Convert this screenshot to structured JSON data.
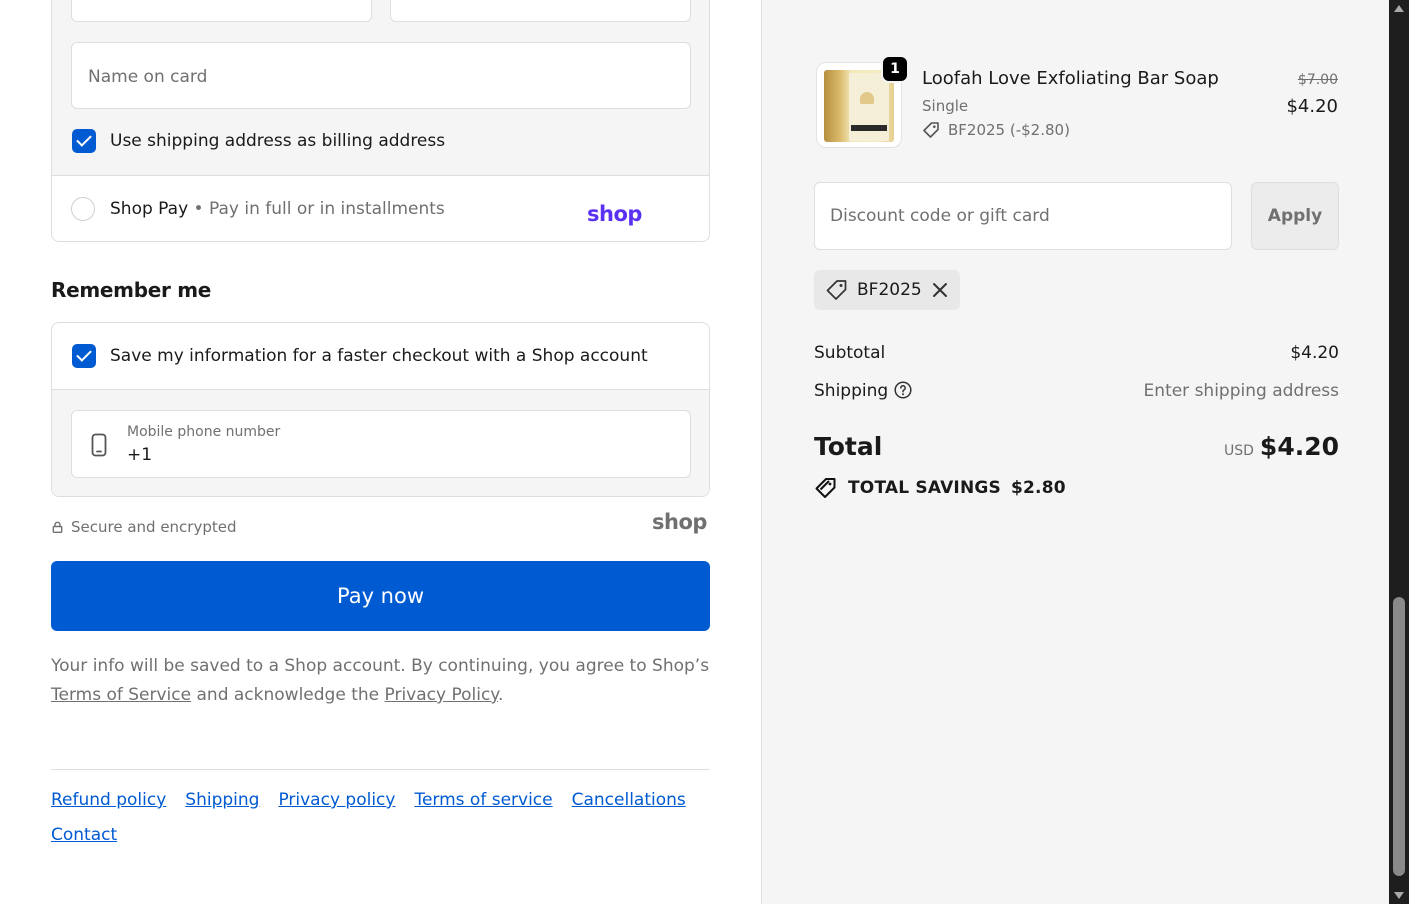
{
  "payment": {
    "name_on_card_placeholder": "Name on card",
    "billing_same_label": "Use shipping address as billing address",
    "billing_same_checked": true,
    "shop_pay_label": "Shop Pay",
    "shop_pay_bullet": "•",
    "shop_pay_sub": "Pay in full or in installments",
    "shop_logo_text": "shop"
  },
  "remember": {
    "title": "Remember me",
    "save_label": "Save my information for a faster checkout with a Shop account",
    "save_checked": true,
    "phone_label": "Mobile phone number",
    "phone_value": "+1"
  },
  "security": {
    "secure_text": "Secure and encrypted",
    "shop_logo_text": "shop"
  },
  "pay_button_label": "Pay now",
  "legal": {
    "text_1": "Your info will be saved to a Shop account. By continuing, you agree to Shop’s ",
    "terms_link": "Terms of Service",
    "text_2": " and acknowledge the ",
    "privacy_link": "Privacy Policy",
    "text_3": "."
  },
  "footer_links": [
    "Refund policy",
    "Shipping",
    "Privacy policy",
    "Terms of service",
    "Cancellations",
    "Contact"
  ],
  "order": {
    "quantity": "1",
    "product_name": "Loofah Love Exfoliating Bar Soap",
    "variant": "Single",
    "discount_line": "BF2025 (-$2.80)",
    "price_original": "$7.00",
    "price_current": "$4.20"
  },
  "discount": {
    "placeholder": "Discount code or gift card",
    "apply_label": "Apply",
    "applied_code": "BF2025"
  },
  "summary": {
    "subtotal_label": "Subtotal",
    "subtotal_value": "$4.20",
    "shipping_label": "Shipping",
    "shipping_value": "Enter shipping address",
    "total_label": "Total",
    "currency": "USD",
    "total_value": "$4.20",
    "savings_label": "TOTAL SAVINGS",
    "savings_value": "$2.80"
  },
  "colors": {
    "accent": "#005bd3",
    "shop_purple": "#5a31f4",
    "panel_bg": "#f5f5f5"
  }
}
